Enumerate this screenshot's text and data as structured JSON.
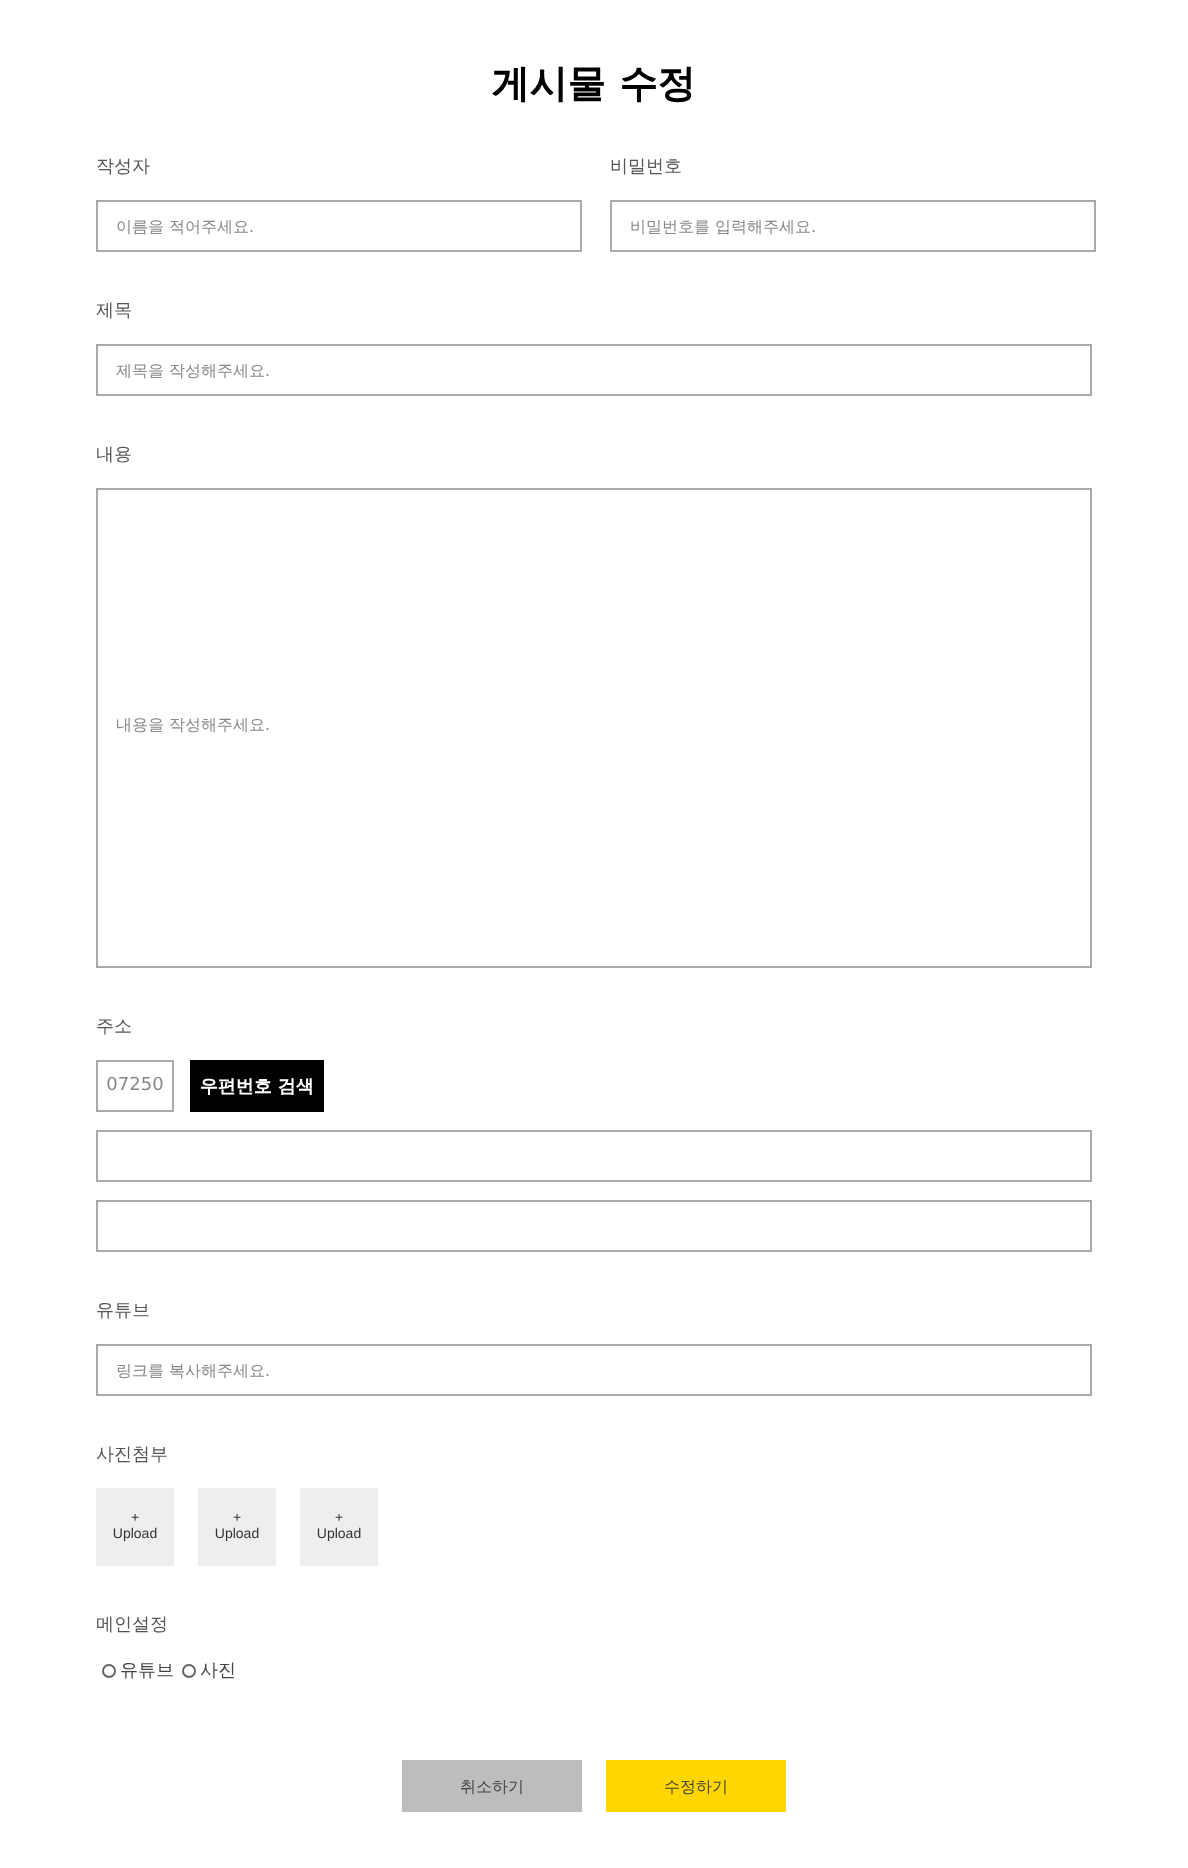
{
  "title": "게시물 수정",
  "writer": {
    "label": "작성자",
    "placeholder": "이름을 적어주세요."
  },
  "password": {
    "label": "비밀번호",
    "placeholder": "비밀번호를 입력해주세요."
  },
  "subject": {
    "label": "제목",
    "placeholder": "제목을 작성해주세요."
  },
  "contents": {
    "label": "내용",
    "placeholder": "내용을 작성해주세요."
  },
  "address": {
    "label": "주소",
    "zipcode": {
      "placeholder": "07250"
    },
    "search_button": "우편번호 검색"
  },
  "youtube": {
    "label": "유튜브",
    "placeholder": "링크를 복사해주세요."
  },
  "photos": {
    "label": "사진첨부",
    "tiles": [
      {
        "plus": "+",
        "text": "Upload"
      },
      {
        "plus": "+",
        "text": "Upload"
      },
      {
        "plus": "+",
        "text": "Upload"
      }
    ]
  },
  "main_setting": {
    "label": "메인설정",
    "options": [
      {
        "label": "유튜브",
        "selected": false
      },
      {
        "label": "사진",
        "selected": false
      }
    ]
  },
  "buttons": [
    {
      "kind": "cancel",
      "label": "취소하기"
    },
    {
      "kind": "submit",
      "label": "수정하기"
    }
  ]
}
